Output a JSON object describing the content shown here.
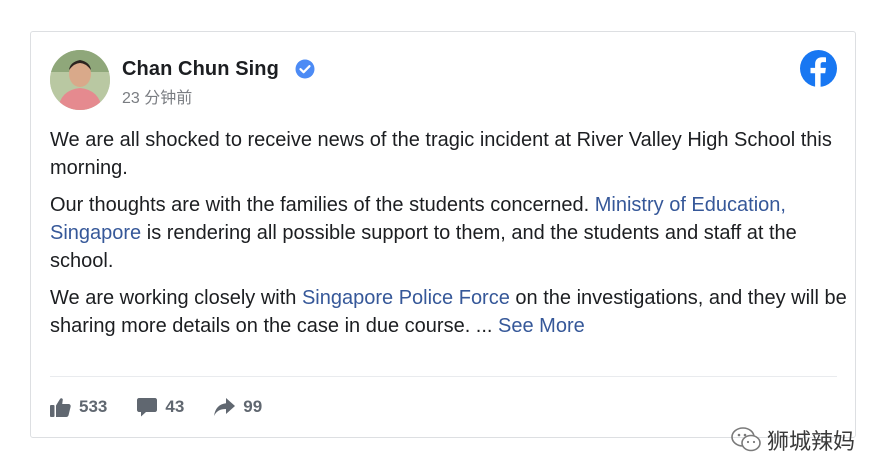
{
  "post": {
    "author": "Chan Chun Sing",
    "timestamp": "23 分钟前",
    "verified_icon": "verified-badge-icon",
    "platform_icon": "facebook-logo-icon",
    "para1": "We are all shocked to receive news of the tragic incident at River Valley High School this morning.",
    "para2_text_a": "Our thoughts are with the families of the students concerned. ",
    "para2_link": "Ministry of Education, Singapore",
    "para2_text_b": " is rendering all possible support to them, and the students and staff at the school.",
    "para3_text_a": "We are working closely with ",
    "para3_link": "Singapore Police Force",
    "para3_text_b": " on the investigations, and they will be sharing more details on the case in due course. ... ",
    "see_more": "See More"
  },
  "stats": {
    "likes": "533",
    "comments": "43",
    "shares": "99"
  },
  "watermark": {
    "text": "狮城辣妈"
  },
  "colors": {
    "link": "#365899",
    "facebook_blue": "#1877f2",
    "text": "#1c1e21",
    "muted": "#606770"
  }
}
